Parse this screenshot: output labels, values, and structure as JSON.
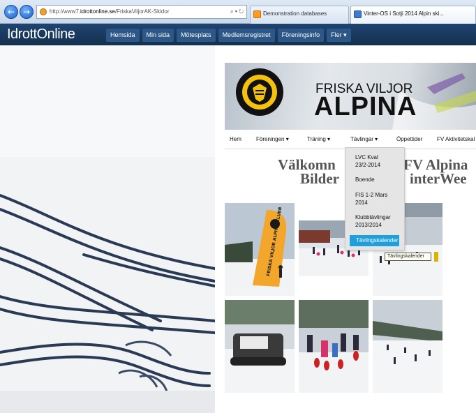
{
  "browser": {
    "back_icon": "arrow-left-icon",
    "forward_icon": "arrow-right-icon",
    "address_prefix": "http://www7.",
    "address_domain": "idrottonline.se",
    "address_path": "/FriskaViljorAK-Skidor",
    "address_controls": "⌕ ▾ ↻",
    "tabs": [
      {
        "label": "Demonstration databases"
      },
      {
        "label": "Vinter-OS i Sotji 2014 Alpin ski..."
      }
    ]
  },
  "site": {
    "logo": "IdrottOnline",
    "nav": [
      "Hemsida",
      "Min sida",
      "Mötesplats",
      "Medlemsregistret",
      "Föreningsinfo",
      "Fler ▾"
    ]
  },
  "banner": {
    "name_line1": "FRISKA VILJOR",
    "name_line2": "ALPINA",
    "logo_ring_text": "FRISKA · VILJOR · ALPINA · KLUBB"
  },
  "club_nav": [
    "Hem",
    "Föreningen ▾",
    "Träning ▾",
    "Tävlingar ▾",
    "Öppettider",
    "FV Aktivitetskal"
  ],
  "dropdown": {
    "items": [
      {
        "line1": "LVC Kval",
        "line2": "23/2-2014"
      },
      {
        "line1": "Boende",
        "line2": ""
      },
      {
        "line1": "FIS 1-2 Mars",
        "line2": "2014"
      },
      {
        "line1": "Klubbtävlingar",
        "line2": "2013/2014"
      }
    ],
    "active": "Tävlingskalender"
  },
  "tooltip": "Tävlingskalender",
  "welcome": {
    "line1_left": "Välkomn",
    "line1_right": "FV Alpina",
    "line2_left": "Bilder",
    "line2_right": "interWee"
  },
  "flag_text": "FRISKA VILJOR ALPINA KLUBB",
  "colors": {
    "site_header": "#1f4470",
    "dropdown_active": "#1fa0dd",
    "heading": "#555555"
  }
}
